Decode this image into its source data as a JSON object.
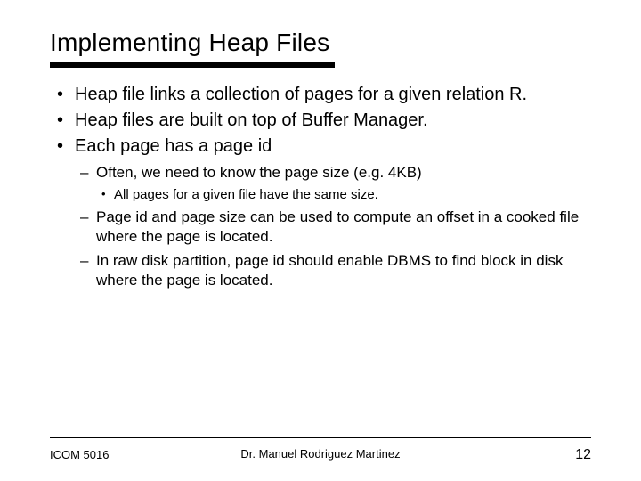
{
  "title": "Implementing Heap Files",
  "bullets": {
    "b1": "Heap file links a collection of pages for a given relation R.",
    "b2": "Heap files are built on top of Buffer Manager.",
    "b3": "Each page has a page id",
    "b3_1": "Often, we need to know the page size (e.g. 4KB)",
    "b3_1_1": "All pages for a given file have the same size.",
    "b3_2": "Page id and page size can be used to compute an offset in a cooked file where the page is located.",
    "b3_3": "In raw disk partition, page id should enable DBMS to find block in disk where the page is located."
  },
  "footer": {
    "course": "ICOM 5016",
    "author": "Dr. Manuel Rodriguez Martinez",
    "page": "12"
  }
}
